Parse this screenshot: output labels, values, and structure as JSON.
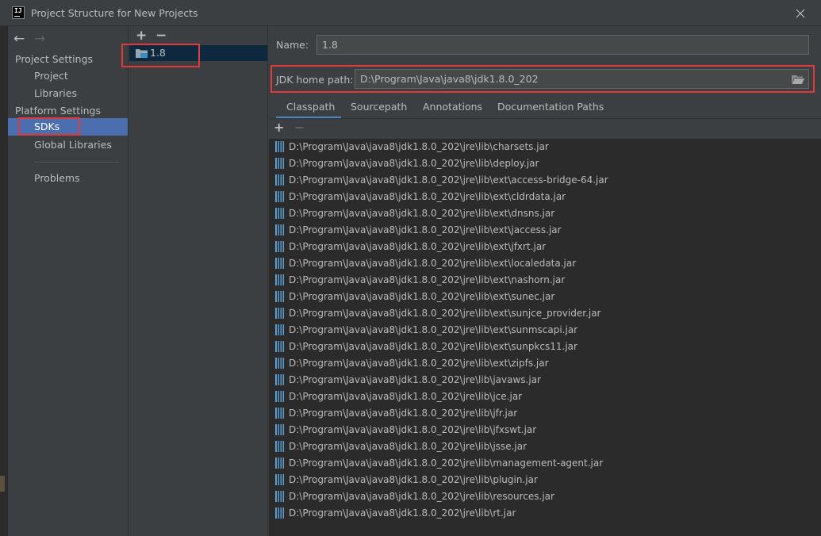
{
  "window": {
    "title": "Project Structure for New Projects"
  },
  "sidebar": {
    "project_settings_header": "Project Settings",
    "platform_settings_header": "Platform Settings",
    "items": {
      "project": "Project",
      "libraries": "Libraries",
      "sdks": "SDKs",
      "global_libraries": "Global Libraries",
      "problems": "Problems"
    },
    "selected": "SDKs"
  },
  "sdk_list": {
    "items": [
      "1.8"
    ],
    "selected": "1.8"
  },
  "sdk_detail": {
    "name_label": "Name:",
    "name_value": "1.8",
    "jdk_home_label": "JDK home path:",
    "jdk_home_value": "D:\\Program\\Java\\java8\\jdk1.8.0_202",
    "tabs": [
      "Classpath",
      "Sourcepath",
      "Annotations",
      "Documentation Paths"
    ],
    "active_tab": "Classpath",
    "classpath": [
      "D:\\Program\\Java\\java8\\jdk1.8.0_202\\jre\\lib\\charsets.jar",
      "D:\\Program\\Java\\java8\\jdk1.8.0_202\\jre\\lib\\deploy.jar",
      "D:\\Program\\Java\\java8\\jdk1.8.0_202\\jre\\lib\\ext\\access-bridge-64.jar",
      "D:\\Program\\Java\\java8\\jdk1.8.0_202\\jre\\lib\\ext\\cldrdata.jar",
      "D:\\Program\\Java\\java8\\jdk1.8.0_202\\jre\\lib\\ext\\dnsns.jar",
      "D:\\Program\\Java\\java8\\jdk1.8.0_202\\jre\\lib\\ext\\jaccess.jar",
      "D:\\Program\\Java\\java8\\jdk1.8.0_202\\jre\\lib\\ext\\jfxrt.jar",
      "D:\\Program\\Java\\java8\\jdk1.8.0_202\\jre\\lib\\ext\\localedata.jar",
      "D:\\Program\\Java\\java8\\jdk1.8.0_202\\jre\\lib\\ext\\nashorn.jar",
      "D:\\Program\\Java\\java8\\jdk1.8.0_202\\jre\\lib\\ext\\sunec.jar",
      "D:\\Program\\Java\\java8\\jdk1.8.0_202\\jre\\lib\\ext\\sunjce_provider.jar",
      "D:\\Program\\Java\\java8\\jdk1.8.0_202\\jre\\lib\\ext\\sunmscapi.jar",
      "D:\\Program\\Java\\java8\\jdk1.8.0_202\\jre\\lib\\ext\\sunpkcs11.jar",
      "D:\\Program\\Java\\java8\\jdk1.8.0_202\\jre\\lib\\ext\\zipfs.jar",
      "D:\\Program\\Java\\java8\\jdk1.8.0_202\\jre\\lib\\javaws.jar",
      "D:\\Program\\Java\\java8\\jdk1.8.0_202\\jre\\lib\\jce.jar",
      "D:\\Program\\Java\\java8\\jdk1.8.0_202\\jre\\lib\\jfr.jar",
      "D:\\Program\\Java\\java8\\jdk1.8.0_202\\jre\\lib\\jfxswt.jar",
      "D:\\Program\\Java\\java8\\jdk1.8.0_202\\jre\\lib\\jsse.jar",
      "D:\\Program\\Java\\java8\\jdk1.8.0_202\\jre\\lib\\management-agent.jar",
      "D:\\Program\\Java\\java8\\jdk1.8.0_202\\jre\\lib\\plugin.jar",
      "D:\\Program\\Java\\java8\\jdk1.8.0_202\\jre\\lib\\resources.jar",
      "D:\\Program\\Java\\java8\\jdk1.8.0_202\\jre\\lib\\rt.jar"
    ]
  },
  "icons": {
    "app": "intellij-icon",
    "close": "close-icon",
    "back": "arrow-left-icon",
    "forward": "arrow-right-icon",
    "add": "plus-icon",
    "remove": "minus-icon",
    "sdk": "sdk-folder-icon",
    "browse": "folder-open-icon",
    "jar": "jar-file-icon"
  },
  "colors": {
    "background": "#3c3f41",
    "list_background": "#2b2b2b",
    "selection": "#4b6eaf",
    "sdk_selection": "#0d293e",
    "tab_underline": "#4a88c7",
    "annotation_red": "#e0393e",
    "text": "#bbbbbb"
  }
}
